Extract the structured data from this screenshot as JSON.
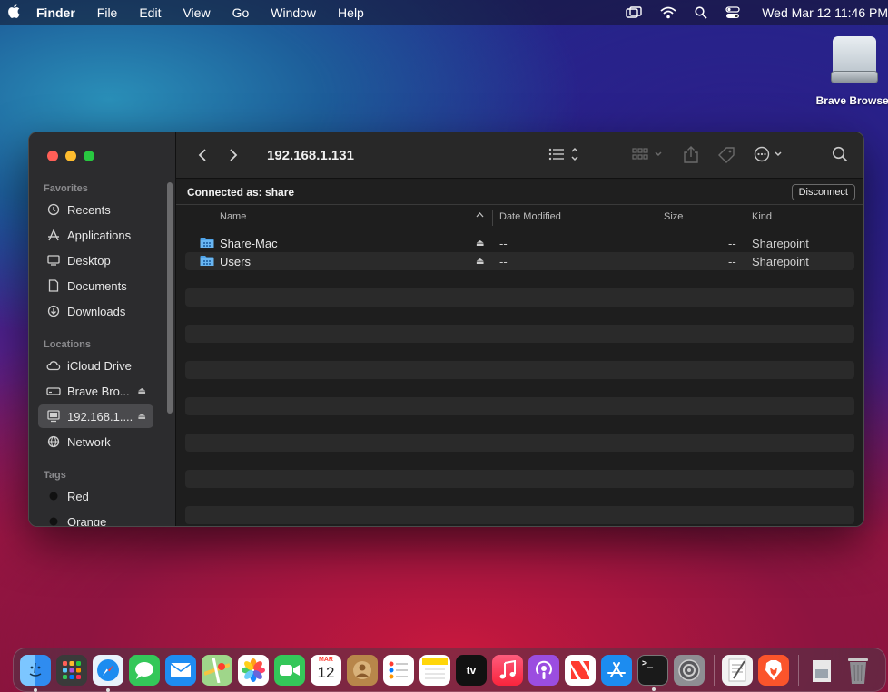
{
  "menubar": {
    "apple": "",
    "app_name": "Finder",
    "items": [
      "File",
      "Edit",
      "View",
      "Go",
      "Window",
      "Help"
    ],
    "clock": "Wed Mar 12  11:46 PM"
  },
  "desktop": {
    "drive_label": "Brave Browser"
  },
  "window": {
    "title": "192.168.1.131",
    "connected_text": "Connected as: share",
    "disconnect_label": "Disconnect",
    "sidebar": {
      "favorites_header": "Favorites",
      "favorites": [
        {
          "label": "Recents",
          "icon": "clock-icon"
        },
        {
          "label": "Applications",
          "icon": "applications-icon"
        },
        {
          "label": "Desktop",
          "icon": "desktop-icon"
        },
        {
          "label": "Documents",
          "icon": "document-icon"
        },
        {
          "label": "Downloads",
          "icon": "download-icon"
        }
      ],
      "locations_header": "Locations",
      "locations": [
        {
          "label": "iCloud Drive",
          "icon": "cloud-icon"
        },
        {
          "label": "Brave Bro...",
          "icon": "drive-icon",
          "eject": true
        },
        {
          "label": "192.168.1....",
          "icon": "network-server-icon",
          "eject": true,
          "selected": true
        },
        {
          "label": "Network",
          "icon": "globe-icon"
        }
      ],
      "tags_header": "Tags",
      "tags": [
        {
          "label": "Red",
          "color": "#111111"
        },
        {
          "label": "Orange",
          "color": "#111111"
        }
      ]
    },
    "columns": {
      "name": "Name",
      "date_modified": "Date Modified",
      "size": "Size",
      "kind": "Kind"
    },
    "rows": [
      {
        "name": "Share-Mac",
        "date": "--",
        "size": "--",
        "kind": "Sharepoint"
      },
      {
        "name": "Users",
        "date": "--",
        "size": "--",
        "kind": "Sharepoint"
      }
    ]
  },
  "dock": {
    "calendar_month": "MAR",
    "calendar_day": "12",
    "tv_label": "tv"
  }
}
